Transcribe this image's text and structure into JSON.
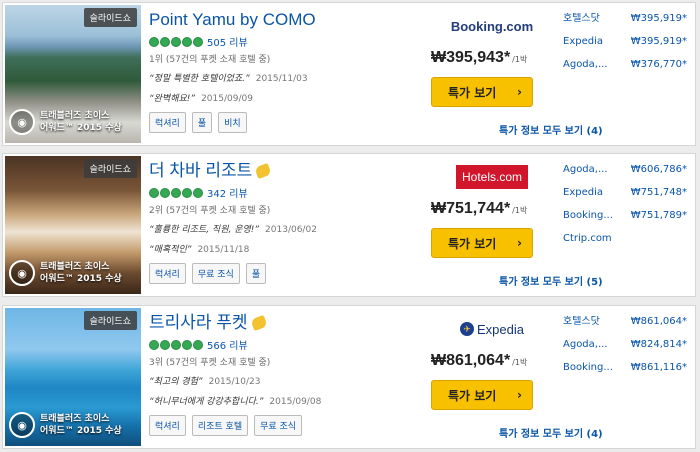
{
  "hotels": [
    {
      "slideshow_label": "슬라이드쇼",
      "award": "트래블러즈 초이스 어워드™ 2015 수상",
      "award_line1": "트래블러즈 초이스",
      "award_line2": "어워드™ 2015 수상",
      "name": "Point Yamu by COMO",
      "has_partner_icon": false,
      "rating_bubbles": 5,
      "reviews": "505 리뷰",
      "rank": "1위 (57건의 푸켓 소재 호텔 중)",
      "quotes": [
        {
          "text": "“정말 특별한 호텔이었죠.”",
          "date": "2015/11/03"
        },
        {
          "text": "“완벽해요!”",
          "date": "2015/09/09"
        }
      ],
      "tags": [
        "럭셔리",
        "풀",
        "비치"
      ],
      "provider": "Booking.com",
      "price": "₩395,943*",
      "per_night": "/1박",
      "deal_button": "특가 보기",
      "chevron": "›",
      "others": [
        {
          "name": "호텔스닷",
          "price": "₩395,919*"
        },
        {
          "name": "Expedia",
          "price": "₩395,919*"
        },
        {
          "name": "Agoda,...",
          "price": "₩376,770*"
        }
      ],
      "more_link": "특가 정보 모두 보기 (4)"
    },
    {
      "slideshow_label": "슬라이드쇼",
      "award_line1": "트래블러즈 초이스",
      "award_line2": "어워드™ 2015 수상",
      "name": "더 차바 리조트",
      "has_partner_icon": true,
      "rating_bubbles": 5,
      "reviews": "342 리뷰",
      "rank": "2위 (57건의 푸켓 소재 호텔 중)",
      "quotes": [
        {
          "text": "“훌륭한 리조트, 직원, 운영!”",
          "date": "2013/06/02"
        },
        {
          "text": "“매혹적인”",
          "date": "2015/11/18"
        }
      ],
      "tags": [
        "럭셔리",
        "무료 조식",
        "풀"
      ],
      "provider": "Hotels.com",
      "price": "₩751,744*",
      "per_night": "/1박",
      "deal_button": "특가 보기",
      "chevron": "›",
      "others": [
        {
          "name": "Agoda,...",
          "price": "₩606,786*"
        },
        {
          "name": "Expedia",
          "price": "₩751,748*"
        },
        {
          "name": "Booking...",
          "price": "₩751,789*"
        },
        {
          "name": "Ctrip.com",
          "price": ""
        }
      ],
      "more_link": "특가 정보 모두 보기 (5)"
    },
    {
      "slideshow_label": "슬라이드쇼",
      "award_line1": "트래블러즈 초이스",
      "award_line2": "어워드™ 2015 수상",
      "name": "트리사라 푸켓",
      "has_partner_icon": true,
      "rating_bubbles": 5,
      "reviews": "566 리뷰",
      "rank": "3위 (57건의 푸켓 소재 호텔 중)",
      "quotes": [
        {
          "text": "“최고의 경험”",
          "date": "2015/10/23"
        },
        {
          "text": "“허니무너에게 강강추합니다.”",
          "date": "2015/09/08"
        }
      ],
      "tags": [
        "럭셔리",
        "리조트 호텔",
        "무료 조식"
      ],
      "provider": "Expedia",
      "price": "₩861,064*",
      "per_night": "/1박",
      "deal_button": "특가 보기",
      "chevron": "›",
      "others": [
        {
          "name": "호텔스닷",
          "price": "₩861,064*"
        },
        {
          "name": "Agoda,...",
          "price": "₩824,814*"
        },
        {
          "name": "Booking...",
          "price": "₩861,116*"
        }
      ],
      "more_link": "특가 정보 모두 보기 (4)"
    }
  ],
  "colors": {
    "link": "#0a55a8",
    "deal_button": "#f7c100",
    "bubble": "#34a853",
    "hotels_logo": "#d1152b"
  }
}
